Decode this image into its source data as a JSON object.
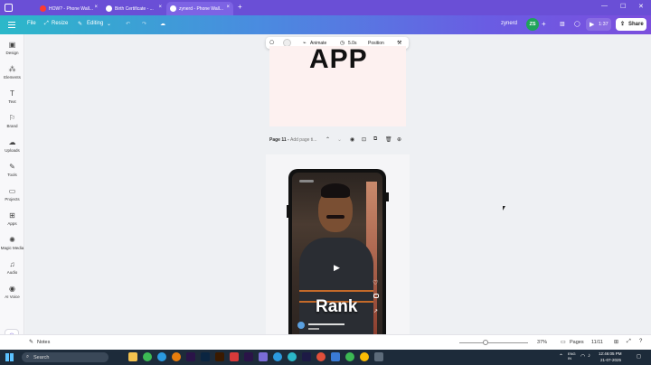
{
  "browser": {
    "tabs": [
      {
        "title": "HOW? - Phone Wall...",
        "close": "×",
        "fav_color": "#ff3b30"
      },
      {
        "title": "Birth Certificate - ...",
        "close": "×",
        "fav_color": "#ffffff"
      },
      {
        "title": "zynerd - Phone Wall...",
        "close": "×",
        "fav_color": "#ffffff"
      }
    ],
    "new_tab": "+",
    "window_controls": {
      "minimize": "—",
      "maximize": "☐",
      "close": "✕"
    }
  },
  "header": {
    "file": "File",
    "resize": "Resize",
    "editing": "Editing",
    "username": "zynerd",
    "avatar_initials": "ZS",
    "play_time": "1:37",
    "share": "Share"
  },
  "rail": [
    {
      "label": "Design",
      "icon": "design-icon"
    },
    {
      "label": "Elements",
      "icon": "elements-icon"
    },
    {
      "label": "Text",
      "icon": "text-icon"
    },
    {
      "label": "Brand",
      "icon": "brand-icon"
    },
    {
      "label": "Uploads",
      "icon": "uploads-icon"
    },
    {
      "label": "Tools",
      "icon": "tools-icon"
    },
    {
      "label": "Projects",
      "icon": "projects-icon"
    },
    {
      "label": "Apps",
      "icon": "apps-icon"
    },
    {
      "label": "Magic Media",
      "icon": "magic-media-icon"
    },
    {
      "label": "Audio",
      "icon": "audio-icon"
    },
    {
      "label": "AI Voice",
      "icon": "ai-voice-icon"
    }
  ],
  "toolbar": {
    "animate": "Animate",
    "duration": "5.0s",
    "position": "Position"
  },
  "page_top": {
    "text": "APP"
  },
  "page11": {
    "label": "Page 11 -",
    "title_placeholder": "Add page ti..."
  },
  "video": {
    "caption": "Rank"
  },
  "footer": {
    "notes": "Notes",
    "zoom": "37%",
    "pages": "Pages",
    "page_count": "11/11"
  },
  "taskbar": {
    "search": "Search",
    "lang": "ENG\nIN",
    "time": "12:46:05 PM",
    "date": "21-07-2025"
  },
  "colors": {
    "accent": "#7b4fdd",
    "avatar": "#1fa35a",
    "taskbar": "#1d2b3a"
  }
}
